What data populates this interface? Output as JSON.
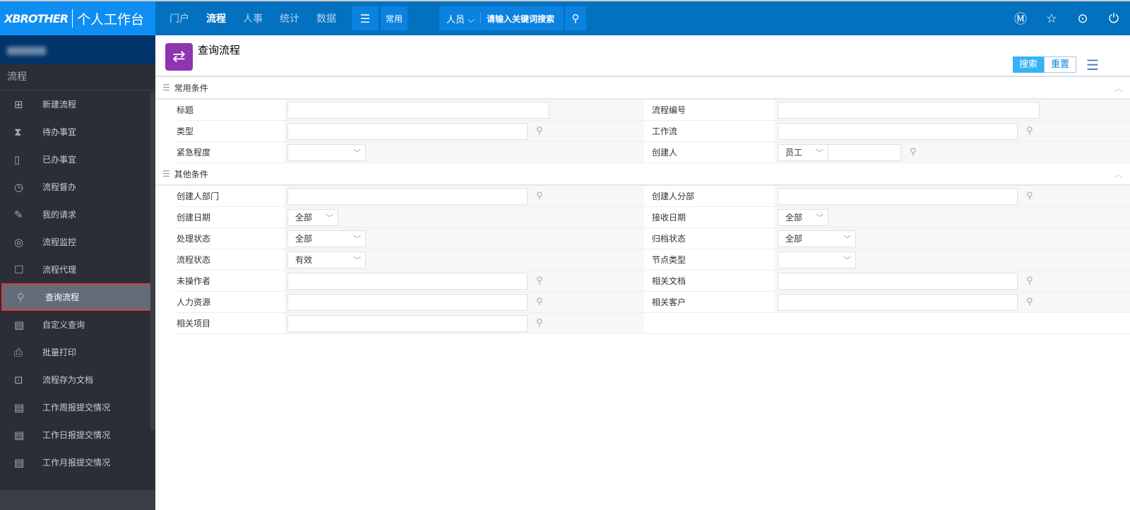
{
  "header": {
    "logo": "XBROTHER",
    "app_title": "个人工作台",
    "nav": [
      "门户",
      "流程",
      "人事",
      "统计",
      "数据"
    ],
    "active_nav": "流程",
    "menu_icon": "hamburger-icon",
    "common_label": "常用",
    "search_scope": "人员",
    "search_placeholder": "请输入关键词搜索",
    "icons": [
      "m-circle-icon",
      "star-icon",
      "more-icon",
      "power-icon"
    ]
  },
  "sidebar": {
    "section": "流程",
    "items": [
      {
        "label": "新建流程",
        "icon": "new-doc-icon",
        "glyph": "⊞"
      },
      {
        "label": "待办事宜",
        "icon": "hourglass-icon",
        "glyph": "⧗"
      },
      {
        "label": "已办事宜",
        "icon": "done-doc-icon",
        "glyph": "▯"
      },
      {
        "label": "流程督办",
        "icon": "alarm-icon",
        "glyph": "◷"
      },
      {
        "label": "我的请求",
        "icon": "edit-icon",
        "glyph": "✎"
      },
      {
        "label": "流程监控",
        "icon": "monitor-icon",
        "glyph": "◎"
      },
      {
        "label": "流程代理",
        "icon": "agent-icon",
        "glyph": "☐"
      },
      {
        "label": "查询流程",
        "icon": "search-icon",
        "glyph": "⚲",
        "active": true
      },
      {
        "label": "自定义查询",
        "icon": "list-doc-icon",
        "glyph": "▤"
      },
      {
        "label": "批量打印",
        "icon": "printer-icon",
        "glyph": "⎙"
      },
      {
        "label": "流程存为文档",
        "icon": "save-doc-icon",
        "glyph": "⊡"
      },
      {
        "label": "工作周报提交情况",
        "icon": "report-icon",
        "glyph": "▤"
      },
      {
        "label": "工作日报提交情况",
        "icon": "report-icon",
        "glyph": "▤"
      },
      {
        "label": "工作月报提交情况",
        "icon": "report-icon",
        "glyph": "▤"
      }
    ]
  },
  "page": {
    "title": "查询流程",
    "search_btn": "搜索",
    "reset_btn": "重置"
  },
  "sections": [
    {
      "title": "常用条件",
      "rows": [
        [
          {
            "label": "标题",
            "type": "text"
          },
          {
            "label": "流程编号",
            "type": "text"
          }
        ],
        [
          {
            "label": "类型",
            "type": "browse"
          },
          {
            "label": "工作流",
            "type": "browse"
          }
        ],
        [
          {
            "label": "紧急程度",
            "type": "select",
            "value": ""
          },
          {
            "label": "创建人",
            "type": "creator",
            "value": "员工"
          }
        ]
      ]
    },
    {
      "title": "其他条件",
      "rows": [
        [
          {
            "label": "创建人部门",
            "type": "browse"
          },
          {
            "label": "创建人分部",
            "type": "browse"
          }
        ],
        [
          {
            "label": "创建日期",
            "type": "select-s",
            "value": "全部"
          },
          {
            "label": "接收日期",
            "type": "select-s",
            "value": "全部"
          }
        ],
        [
          {
            "label": "处理状态",
            "type": "select",
            "value": "全部"
          },
          {
            "label": "归档状态",
            "type": "select",
            "value": "全部"
          }
        ],
        [
          {
            "label": "流程状态",
            "type": "select",
            "value": "有效"
          },
          {
            "label": "节点类型",
            "type": "select",
            "value": ""
          }
        ],
        [
          {
            "label": "未操作者",
            "type": "browse"
          },
          {
            "label": "相关文档",
            "type": "browse"
          }
        ],
        [
          {
            "label": "人力资源",
            "type": "browse"
          },
          {
            "label": "相关客户",
            "type": "browse"
          }
        ],
        [
          {
            "label": "相关项目",
            "type": "browse"
          },
          null
        ]
      ]
    }
  ]
}
